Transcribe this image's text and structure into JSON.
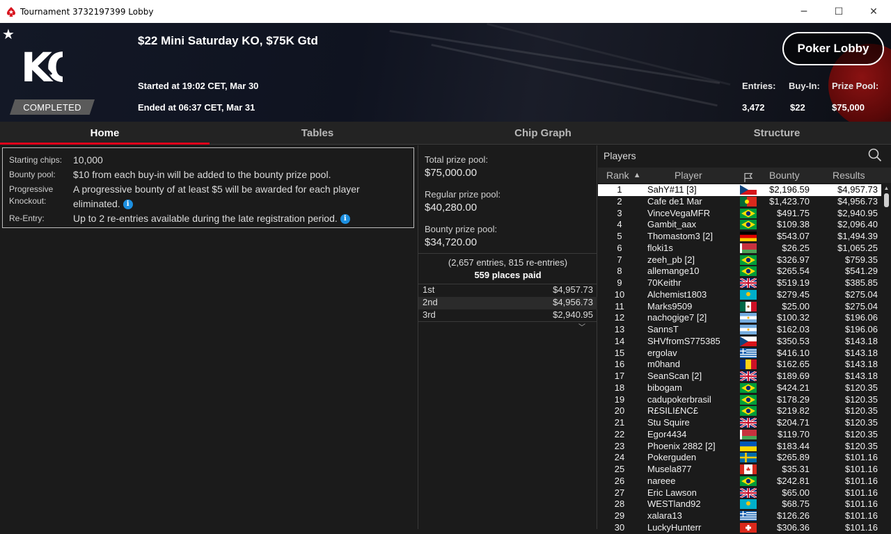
{
  "window": {
    "title": "Tournament 3732197399 Lobby",
    "minimize": "─",
    "maximize": "☐",
    "close": "✕"
  },
  "header": {
    "logo_text": "KO",
    "status": "COMPLETED",
    "title": "$22 Mini Saturday KO, $75K Gtd",
    "started": "Started at 19:02 CET, Mar 30",
    "ended": "Ended at 06:37 CET, Mar 31",
    "lobby_button": "Poker Lobby",
    "entries_label": "Entries:",
    "entries_value": "3,472",
    "buyin_label": "Buy-In:",
    "buyin_value": "$22",
    "prizepool_label": "Prize Pool:",
    "prizepool_value": "$75,000"
  },
  "tabs": [
    "Home",
    "Tables",
    "Chip Graph",
    "Structure"
  ],
  "info": {
    "starting_chips_label": "Starting chips:",
    "starting_chips_value": "10,000",
    "bounty_pool_label": "Bounty pool:",
    "bounty_pool_value": "$10 from each buy-in will be added to the bounty prize pool.",
    "progressive_label_1": "Progressive",
    "progressive_label_2": "Knockout:",
    "progressive_value_1": "A progressive bounty of at least $5 will be awarded for each player",
    "progressive_value_2": "eliminated.",
    "reentry_label": "Re-Entry:",
    "reentry_value": "Up to 2 re-entries available during the late registration period."
  },
  "prize": {
    "total_label": "Total prize pool:",
    "total_value": "$75,000.00",
    "regular_label": "Regular prize pool:",
    "regular_value": "$40,280.00",
    "bounty_label": "Bounty prize pool:",
    "bounty_value": "$34,720.00",
    "entries_note": "(2,657 entries, 815 re-entries)",
    "places_paid": "559 places paid",
    "places": [
      {
        "place": "1st",
        "amount": "$4,957.73"
      },
      {
        "place": "2nd",
        "amount": "$4,956.73"
      },
      {
        "place": "3rd",
        "amount": "$2,940.95"
      }
    ]
  },
  "players": {
    "title": "Players",
    "headers": {
      "rank": "Rank",
      "player": "Player",
      "bounty": "Bounty",
      "results": "Results"
    },
    "rows": [
      {
        "rank": "1",
        "name": "SahY#11 [3]",
        "flag": "cz",
        "bounty": "$2,196.59",
        "result": "$4,957.73"
      },
      {
        "rank": "2",
        "name": "Cafe de1 Mar",
        "flag": "pt",
        "bounty": "$1,423.70",
        "result": "$4,956.73"
      },
      {
        "rank": "3",
        "name": "VinceVegaMFR",
        "flag": "br",
        "bounty": "$491.75",
        "result": "$2,940.95"
      },
      {
        "rank": "4",
        "name": "Gambit_aax",
        "flag": "br",
        "bounty": "$109.38",
        "result": "$2,096.40"
      },
      {
        "rank": "5",
        "name": "Thomastom3 [2]",
        "flag": "de",
        "bounty": "$543.07",
        "result": "$1,494.39"
      },
      {
        "rank": "6",
        "name": "floki1s",
        "flag": "by",
        "bounty": "$26.25",
        "result": "$1,065.25"
      },
      {
        "rank": "7",
        "name": "zeeh_pb [2]",
        "flag": "br",
        "bounty": "$326.97",
        "result": "$759.35"
      },
      {
        "rank": "8",
        "name": "allemange10",
        "flag": "br",
        "bounty": "$265.54",
        "result": "$541.29"
      },
      {
        "rank": "9",
        "name": "70Keithr",
        "flag": "gb",
        "bounty": "$519.19",
        "result": "$385.85"
      },
      {
        "rank": "10",
        "name": "Alchemist1803",
        "flag": "kz",
        "bounty": "$279.45",
        "result": "$275.04"
      },
      {
        "rank": "11",
        "name": "Marks9509",
        "flag": "mx",
        "bounty": "$25.00",
        "result": "$275.04"
      },
      {
        "rank": "12",
        "name": "nachogige7 [2]",
        "flag": "ar",
        "bounty": "$100.32",
        "result": "$196.06"
      },
      {
        "rank": "13",
        "name": "SannsT",
        "flag": "ar",
        "bounty": "$162.03",
        "result": "$196.06"
      },
      {
        "rank": "14",
        "name": "SHVfromS775385",
        "flag": "cz",
        "bounty": "$350.53",
        "result": "$143.18"
      },
      {
        "rank": "15",
        "name": "ergolav",
        "flag": "gr",
        "bounty": "$416.10",
        "result": "$143.18"
      },
      {
        "rank": "16",
        "name": "m0hand",
        "flag": "ro",
        "bounty": "$162.65",
        "result": "$143.18"
      },
      {
        "rank": "17",
        "name": "SeanScan [2]",
        "flag": "gb",
        "bounty": "$189.69",
        "result": "$143.18"
      },
      {
        "rank": "18",
        "name": "bibogam",
        "flag": "br",
        "bounty": "$424.21",
        "result": "$120.35"
      },
      {
        "rank": "19",
        "name": "cadupokerbrasil",
        "flag": "br",
        "bounty": "$178.29",
        "result": "$120.35"
      },
      {
        "rank": "20",
        "name": "R£SILI£NC£",
        "flag": "br",
        "bounty": "$219.82",
        "result": "$120.35"
      },
      {
        "rank": "21",
        "name": "Stu Squire",
        "flag": "gb",
        "bounty": "$204.71",
        "result": "$120.35"
      },
      {
        "rank": "22",
        "name": "Egor4434",
        "flag": "by",
        "bounty": "$119.70",
        "result": "$120.35"
      },
      {
        "rank": "23",
        "name": "Phoenix 2882 [2]",
        "flag": "ua",
        "bounty": "$183.44",
        "result": "$120.35"
      },
      {
        "rank": "24",
        "name": "Pokerguden",
        "flag": "se",
        "bounty": "$265.89",
        "result": "$101.16"
      },
      {
        "rank": "25",
        "name": "Musela877",
        "flag": "ca",
        "bounty": "$35.31",
        "result": "$101.16"
      },
      {
        "rank": "26",
        "name": "nareee",
        "flag": "br",
        "bounty": "$242.81",
        "result": "$101.16"
      },
      {
        "rank": "27",
        "name": "Eric Lawson",
        "flag": "gb",
        "bounty": "$65.00",
        "result": "$101.16"
      },
      {
        "rank": "28",
        "name": "WESTland92",
        "flag": "kz",
        "bounty": "$68.75",
        "result": "$101.16"
      },
      {
        "rank": "29",
        "name": "xalara13",
        "flag": "gr",
        "bounty": "$126.26",
        "result": "$101.16"
      },
      {
        "rank": "30",
        "name": "LuckyHunterr",
        "flag": "ch",
        "bounty": "$306.36",
        "result": "$101.16"
      }
    ]
  },
  "colors": {
    "accent": "#e3001b",
    "info": "#1c8fe0",
    "background": "#1b1b1b"
  }
}
